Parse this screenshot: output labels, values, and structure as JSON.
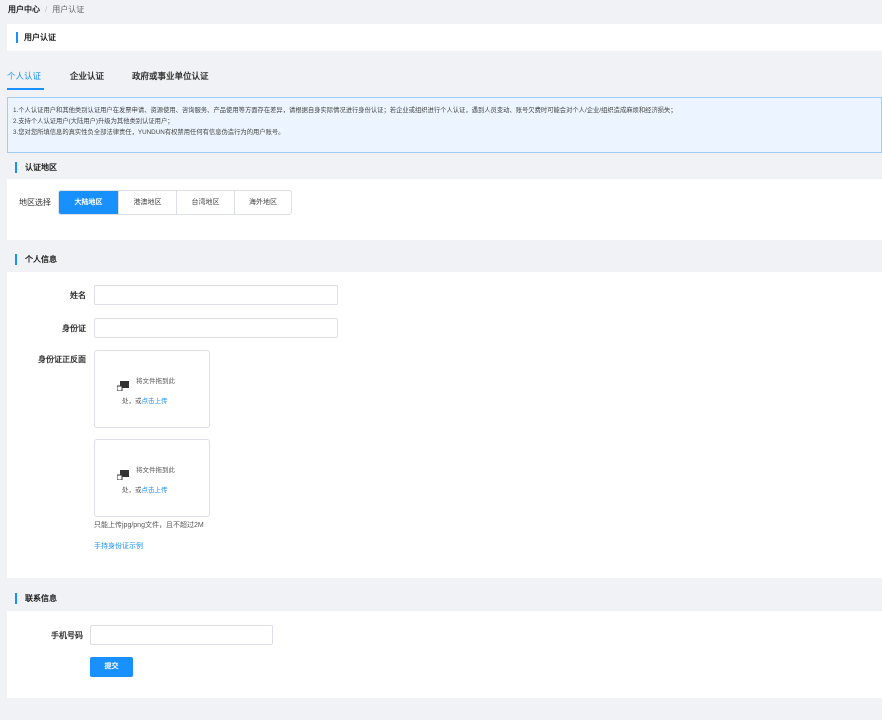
{
  "breadcrumb": {
    "root": "用户中心",
    "separator": "/",
    "current": "用户认证"
  },
  "page_title": "用户认证",
  "tabs": [
    {
      "label": "个人认证",
      "active": true
    },
    {
      "label": "企业认证",
      "active": false
    },
    {
      "label": "政府或事业单位认证",
      "active": false
    }
  ],
  "notice": {
    "lines": [
      "1.个人认证用户和其他类别认证用户在发票申请、资源使用、咨询服务、产品使用等方面存在差异，请根据自身实际情况进行身份认证；若企业或组织进行个人认证，遇到人员变动、账号欠费时可能会对个人/企业/组织造成麻烦和经济损失；",
      "2.支持个人认证用户(大陆用户)升级为其他类别认证用户；",
      "3.您对您所填信息的真实性负全部法律责任，YUNDUN有权禁用任何有信息伪造行为的用户账号。"
    ]
  },
  "region": {
    "section_title": "认证地区",
    "label": "地区选择",
    "options": [
      "大陆地区",
      "港澳地区",
      "台湾地区",
      "海外地区"
    ],
    "selected": "大陆地区"
  },
  "personal": {
    "section_title": "个人信息",
    "name_label": "姓名",
    "name_value": "",
    "id_label": "身份证",
    "id_value": "",
    "idcard_label": "身份证正反面",
    "upload_line1": "将文件拖到此",
    "upload_line2_prefix": "处，或",
    "upload_link": "点击上传",
    "hint": "只能上传jpg/png文件，且不超过2M",
    "example_link": "手持身份证示例"
  },
  "contact": {
    "section_title": "联系信息",
    "phone_label": "手机号码",
    "phone_value": ""
  },
  "submit_label": "提交",
  "colors": {
    "accent": "#1890ff",
    "notice_bg": "#ecf5ff",
    "page_bg": "#f0f2f5"
  },
  "icons": {
    "upload": "upload-icon"
  }
}
